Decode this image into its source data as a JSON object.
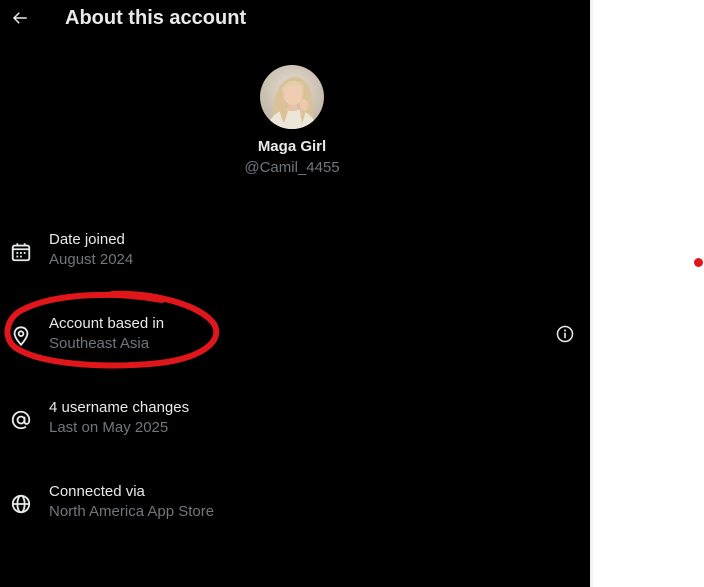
{
  "header": {
    "title": "About this account",
    "back_icon": "arrow-left-icon"
  },
  "profile": {
    "display_name": "Maga Girl",
    "handle": "@Camil_4455"
  },
  "rows": [
    {
      "icon": "calendar-icon",
      "title": "Date joined",
      "subtitle": "August 2024"
    },
    {
      "icon": "location-pin-icon",
      "title": "Account based in",
      "subtitle": "Southeast Asia",
      "info_icon": "info-icon"
    },
    {
      "icon": "at-sign-icon",
      "title": "4 username changes",
      "subtitle": "Last on May 2025"
    },
    {
      "icon": "globe-icon",
      "title": "Connected via",
      "subtitle": "North America App Store"
    }
  ],
  "colors": {
    "background": "#000000",
    "primary_text": "#e7e9ea",
    "secondary_text": "#71767b",
    "annotation": "#e0161b",
    "page_background": "#ffffff"
  }
}
